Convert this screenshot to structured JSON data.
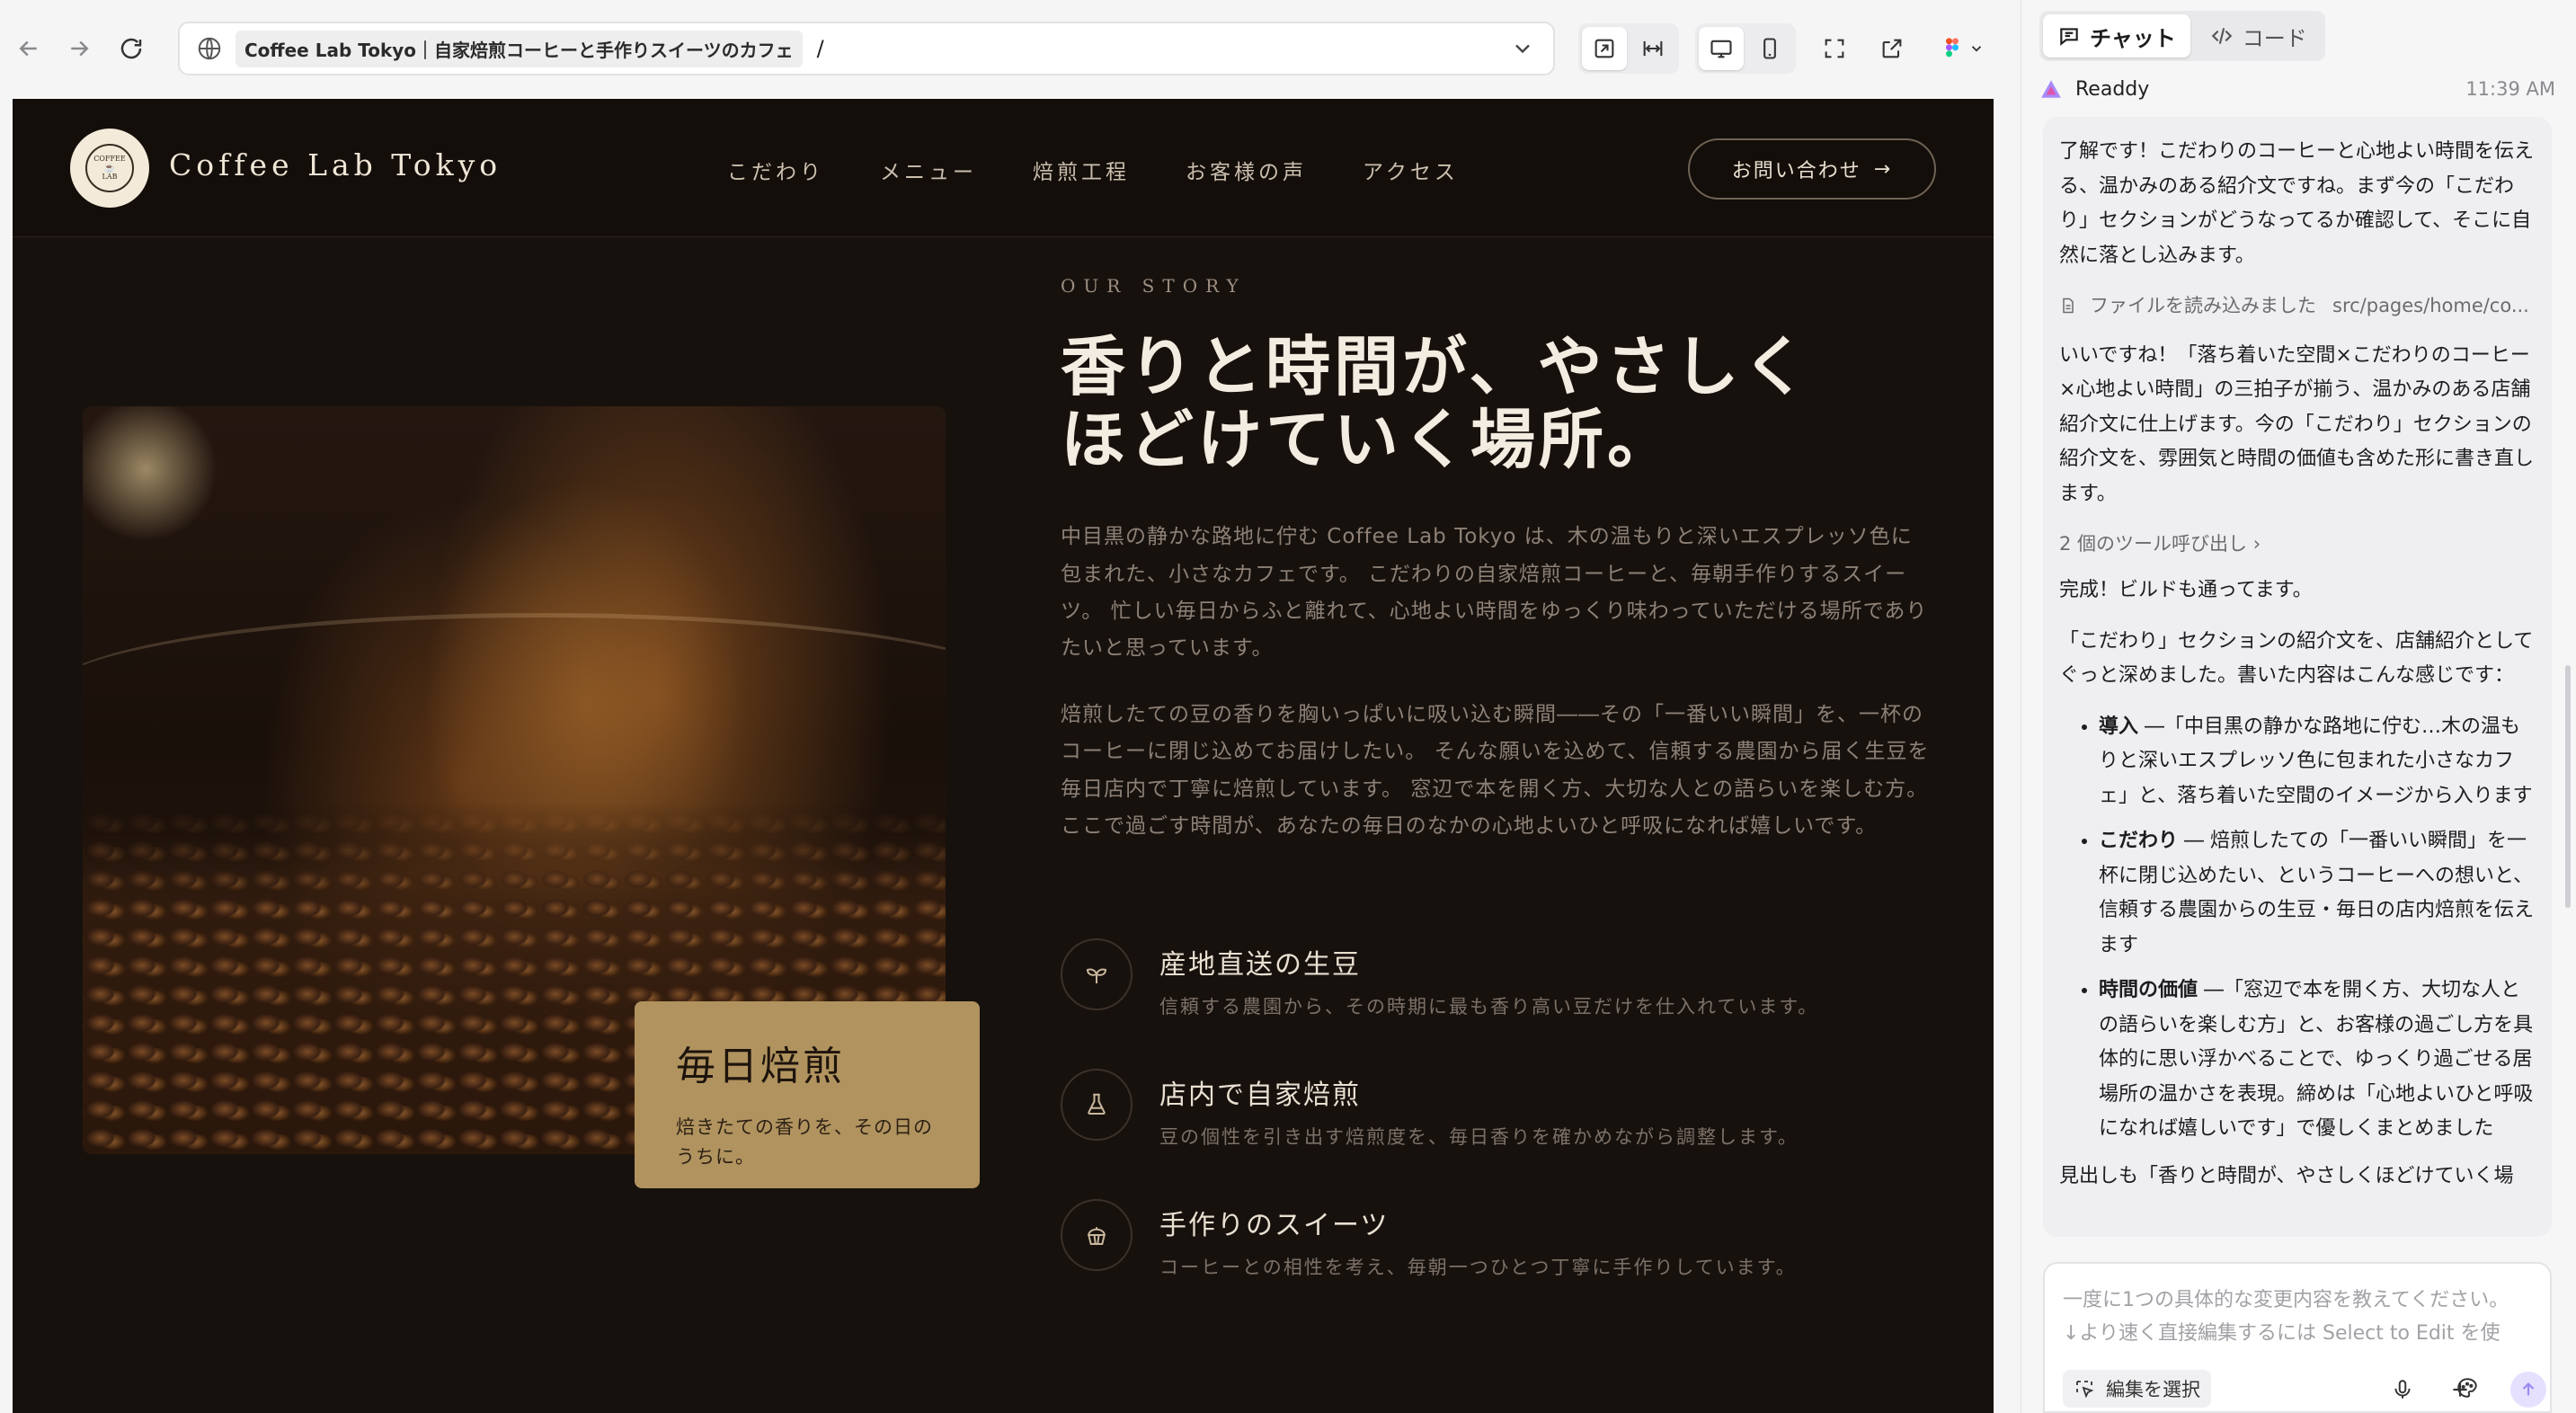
{
  "browser": {
    "tab_title": "Coffee Lab Tokyo｜自家焙煎コーヒーと手作りスイーツのカフェ",
    "path": "/"
  },
  "site": {
    "logo_text_top": "COFFEE",
    "logo_text_bottom": "LAB",
    "brand": "Coffee Lab Tokyo",
    "nav": [
      "こだわり",
      "メニュー",
      "焙煎工程",
      "お客様の声",
      "アクセス"
    ],
    "contact_label": "お問い合わせ",
    "badge_title": "毎日焙煎",
    "badge_sub": "焙きたての香りを、その日のうちに。",
    "eyebrow": "OUR STORY",
    "headline_1": "香りと時間が、やさしく",
    "headline_2": "ほどけていく場所。",
    "para_1": "中目黒の静かな路地に佇む Coffee Lab Tokyo は、木の温もりと深いエスプレッソ色に包まれた、小さなカフェです。 こだわりの自家焙煎コーヒーと、毎朝手作りするスイーツ。 忙しい毎日からふと離れて、心地よい時間をゆっくり味わっていただける場所でありたいと思っています。",
    "para_2": "焙煎したての豆の香りを胸いっぱいに吸い込む瞬間――その「一番いい瞬間」を、一杯のコーヒーに閉じ込めてお届けしたい。 そんな願いを込めて、信頼する農園から届く生豆を毎日店内で丁寧に焙煎しています。 窓辺で本を開く方、大切な人との語らいを楽しむ方。 ここで過ごす時間が、あなたの毎日のなかの心地よいひと呼吸になれば嬉しいです。",
    "features": [
      {
        "icon": "sprout-icon",
        "title": "産地直送の生豆",
        "desc": "信頼する農園から、その時期に最も香り高い豆だけを仕入れています。"
      },
      {
        "icon": "flask-icon",
        "title": "店内で自家焙煎",
        "desc": "豆の個性を引き出す焙煎度を、毎日香りを確かめながら調整します。"
      },
      {
        "icon": "cupcake-icon",
        "title": "手作りのスイーツ",
        "desc": "コーヒーとの相性を考え、毎朝一つひとつ丁寧に手作りしています。"
      }
    ]
  },
  "panel": {
    "tab_chat": "チャット",
    "tab_code": "コード",
    "author": "Readdy",
    "time": "11:39 AM",
    "msg_1": "了解です！こだわりのコーヒーと心地よい時間を伝える、温かみのある紹介文ですね。まず今の「こだわり」セクションがどうなってるか確認して、そこに自然に落とし込みます。",
    "file_label": "ファイルを読み込みました",
    "file_path": "src/pages/home/co...",
    "msg_2": "いいですね！「落ち着いた空間×こだわりのコーヒー×心地よい時間」の三拍子が揃う、温かみのある店舗紹介文に仕上げます。今の「こだわり」セクションの紹介文を、雰囲気と時間の価値も含めた形に書き直します。",
    "tool_calls": "2 個のツール呼び出し",
    "msg_3": "完成！ビルドも通ってます。",
    "msg_4": "「こだわり」セクションの紹介文を、店舗紹介としてぐっと深めました。書いた内容はこんな感じです：",
    "bullets": [
      {
        "head": "導入",
        "text": " ―「中目黒の静かな路地に佇む…木の温もりと深いエスプレッソ色に包まれた小さなカフェ」と、落ち着いた空間のイメージから入ります"
      },
      {
        "head": "こだわり",
        "text": " ― 焙煎したての「一番いい瞬間」を一杯に閉じ込めたい、というコーヒーへの想いと、信頼する農園からの生豆・毎日の店内焙煎を伝えます"
      },
      {
        "head": "時間の価値",
        "text": " ―「窓辺で本を開く方、大切な人との語らいを楽しむ方」と、お客様の過ごし方を具体的に思い浮かべることで、ゆっくり過ごせる居場所の温かさを表現。締めは「心地よいひと呼吸になれば嬉しいです」で優しくまとめました"
      }
    ],
    "msg_5": "見出しも「香りと時間が、やさしくほどけていく場",
    "composer_placeholder_1": "一度に1つの具体的な変更内容を教えてください。",
    "composer_placeholder_2": "↓より速く直接編集するには Select to Edit を使",
    "select_edit": "編集を選択"
  }
}
